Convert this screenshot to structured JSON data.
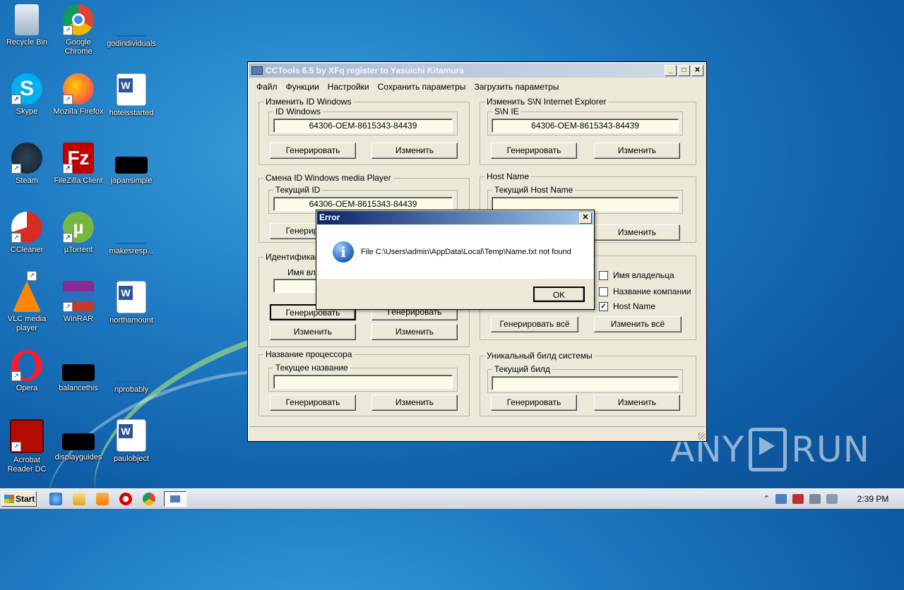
{
  "desktop": {
    "icons": [
      {
        "label": "Recycle Bin",
        "icon": "recycle-bin-icon"
      },
      {
        "label": "Google Chrome",
        "icon": "chrome-icon"
      },
      {
        "label": "godindividuals",
        "icon": "file-icon"
      },
      {
        "label": "Skype",
        "icon": "skype-icon"
      },
      {
        "label": "Mozilla Firefox",
        "icon": "firefox-icon"
      },
      {
        "label": "hotelsstarted",
        "icon": "word-doc-icon"
      },
      {
        "label": "Steam",
        "icon": "steam-icon"
      },
      {
        "label": "FileZilla Client",
        "icon": "filezilla-icon"
      },
      {
        "label": "japansimple",
        "icon": "black-file-icon"
      },
      {
        "label": "CCleaner",
        "icon": "ccleaner-icon"
      },
      {
        "label": "µTorrent",
        "icon": "utorrent-icon"
      },
      {
        "label": "makesresp...",
        "icon": "file-icon"
      },
      {
        "label": "VLC media player",
        "icon": "vlc-icon"
      },
      {
        "label": "WinRAR",
        "icon": "winrar-icon"
      },
      {
        "label": "northamount",
        "icon": "word-doc-icon"
      },
      {
        "label": "Opera",
        "icon": "opera-icon"
      },
      {
        "label": "balancethis",
        "icon": "black-file-icon"
      },
      {
        "label": "nprobably",
        "icon": "file-icon"
      },
      {
        "label": "Acrobat Reader DC",
        "icon": "acrobat-icon"
      },
      {
        "label": "displayguides",
        "icon": "black-file-icon"
      },
      {
        "label": "paulobject",
        "icon": "word-doc-icon"
      }
    ],
    "watermark": "ANY RUN"
  },
  "app": {
    "title": "CCTools 6.5 by XFq register to Yasuichi Kitamura",
    "menu": [
      "Файл",
      "Функции",
      "Настройки",
      "Сохранить параметры",
      "Загрузить параметры"
    ],
    "win_id": {
      "group_label": "Изменить ID Windows",
      "field_label": "ID Windows",
      "value": "64306-OEM-8615343-84439",
      "generate": "Генерировать",
      "change": "Изменить"
    },
    "ie_sn": {
      "group_label": "Изменить S\\N Internet Explorer",
      "field_label": "S\\N IE",
      "value": "64306-OEM-8615343-84439",
      "generate": "Генерировать",
      "change": "Изменить"
    },
    "wmp_id": {
      "group_label": "Смена ID Windows media Player",
      "field_label": "Текущий ID",
      "value": "64306-OEM-8615343-84439",
      "generate": "Генерировать"
    },
    "host": {
      "group_label": "Host Name",
      "field_label": "Текущий Host Name",
      "value": "",
      "change": "Изменить"
    },
    "ident": {
      "group_label": "Идентификац",
      "field_label": "Имя вла",
      "generate1": "Генерировать",
      "generate2": "Генерировать",
      "change1": "Изменить",
      "change2": "Изменить"
    },
    "all": {
      "checkboxes": [
        {
          "label": "Имя владельца",
          "checked": false
        },
        {
          "label": "Название компании",
          "checked": false
        },
        {
          "label": "Host Name",
          "checked": true
        }
      ],
      "generate_all": "Генерировать всё",
      "change_all": "Изменить всё"
    },
    "cpu": {
      "group_label": "Название процессора",
      "field_label": "Текущее название",
      "value": "",
      "generate": "Генерировать",
      "change": "Изменить"
    },
    "build": {
      "group_label": "Уникальный билд системы",
      "field_label": "Текущий билд",
      "value": "",
      "generate": "Генерировать",
      "change": "Изменить"
    }
  },
  "dialog": {
    "title": "Error",
    "message": "File C:\\Users\\admin\\AppData\\Local\\Temp\\Name.txt not found",
    "ok": "OK",
    "icon": "info-icon"
  },
  "taskbar": {
    "start": "Start",
    "clock": "2:39 PM"
  }
}
